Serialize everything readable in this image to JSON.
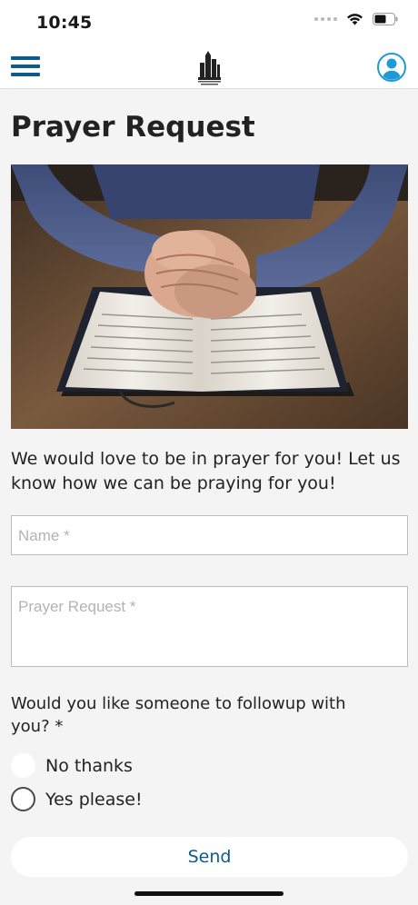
{
  "status_bar": {
    "time": "10:45",
    "icons": [
      "signal-dots",
      "wifi-icon",
      "battery-icon"
    ]
  },
  "nav": {
    "menu_icon": "menu-icon",
    "logo_icon": "church-logo",
    "profile_icon": "profile-icon",
    "accent_color": "#0d5a8c"
  },
  "page": {
    "title": "Prayer Request",
    "intro": "We would love to be in prayer for you!  Let us know how we can be praying for you!"
  },
  "form": {
    "name_placeholder": "Name *",
    "prayer_placeholder": "Prayer Request *",
    "followup_question": "Would you like someone to followup with you? *",
    "options": [
      {
        "label": "No thanks"
      },
      {
        "label": "Yes please!"
      }
    ],
    "send_label": "Send"
  }
}
